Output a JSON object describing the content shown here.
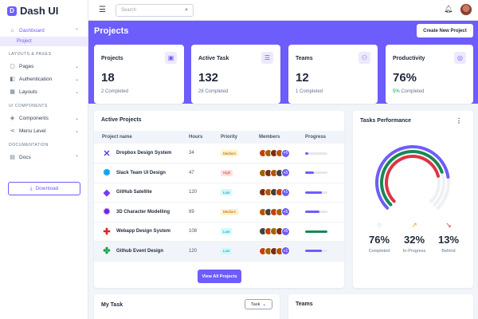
{
  "brand": {
    "name": "Dash UI",
    "logo_letter": "D",
    "accent": "#6d5dfc"
  },
  "sidebar": {
    "dashboard": "Dashboard",
    "dashboard_sub": "Project",
    "layouts_heading": "LAYOUTS & PAGES",
    "pages": "Pages",
    "authentication": "Authentication",
    "layouts": "Layouts",
    "ui_heading": "UI COMPONENTS",
    "components": "Components",
    "menu_level": "Menu Level",
    "doc_heading": "DOCUMENTATION",
    "docs": "Docs",
    "download": "Download"
  },
  "topbar": {
    "search_placeholder": "Search"
  },
  "header": {
    "title": "Projects",
    "new_project": "Create New Project"
  },
  "stats": [
    {
      "title": "Projects",
      "value": "18",
      "sub": "2 Completed",
      "icon": "briefcase-icon"
    },
    {
      "title": "Active Task",
      "value": "132",
      "sub": "28 Completed",
      "icon": "list-icon"
    },
    {
      "title": "Teams",
      "value": "12",
      "sub": "1 Completed",
      "icon": "people-icon"
    },
    {
      "title": "Productivity",
      "value": "76%",
      "sub_highlight": "5%",
      "sub_rest": " Completed",
      "icon": "target-icon"
    }
  ],
  "active_projects": {
    "title": "Active Projects",
    "columns": [
      "Project name",
      "Hours",
      "Priority",
      "Members",
      "Progress"
    ],
    "rows": [
      {
        "name": "Dropbox Design System",
        "hours": "34",
        "priority": "Medium",
        "members": "+5",
        "progress": 0.15,
        "color": "#6d5dfc",
        "icon_color": "#4f46e5"
      },
      {
        "name": "Slack Team UI Design",
        "hours": "47",
        "priority": "High",
        "members": "+5",
        "progress": 0.4,
        "color": "#6d5dfc",
        "icon_color": "#0ea5e9"
      },
      {
        "name": "GitHub Satellite",
        "hours": "120",
        "priority": "Low",
        "members": "+1",
        "progress": 0.75,
        "color": "#6d5dfc",
        "icon_color": "#7c3aed"
      },
      {
        "name": "3D Character Modelling",
        "hours": "89",
        "priority": "Medium",
        "members": "+5",
        "progress": 0.65,
        "color": "#6d5dfc",
        "icon_color": "#6d28d9"
      },
      {
        "name": "Webapp Design System",
        "hours": "108",
        "priority": "Low",
        "members": "+5",
        "progress": 1.0,
        "color": "#198754",
        "icon_color": "#dc2626"
      },
      {
        "name": "Github Event Design",
        "hours": "120",
        "priority": "Low",
        "members": "+1",
        "progress": 0.75,
        "color": "#6d5dfc",
        "icon_color": "#16a34a"
      }
    ],
    "view_all": "View All Projects"
  },
  "tasks_performance": {
    "title": "Tasks Performance",
    "menu": "⋮",
    "metrics": [
      {
        "value": "76%",
        "label": "Completed",
        "fraction": 0.76,
        "color": "#198754",
        "icon": "check-circle-icon"
      },
      {
        "value": "32%",
        "label": "In-Progress",
        "fraction": 0.32,
        "color": "#f59e0b",
        "icon": "trending-up-icon"
      },
      {
        "value": "13%",
        "label": "Behind",
        "fraction": 0.13,
        "color": "#dc3545",
        "icon": "trending-down-icon"
      }
    ]
  },
  "my_task": {
    "title": "My Task",
    "dropdown": "Task"
  },
  "teams": {
    "title": "Teams"
  }
}
